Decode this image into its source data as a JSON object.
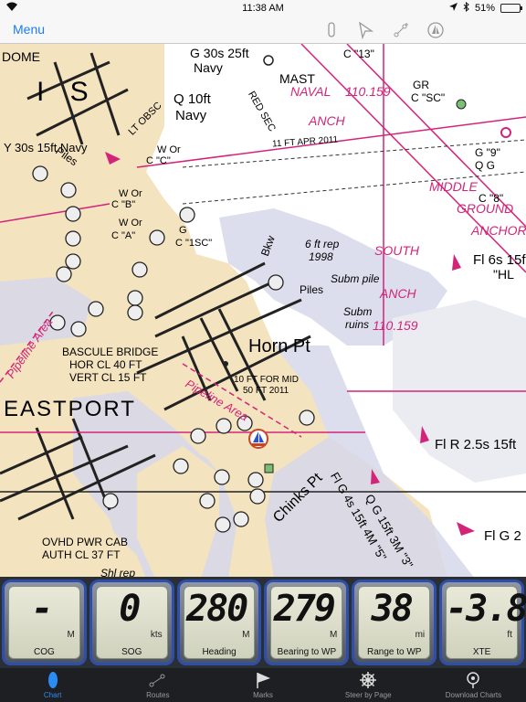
{
  "status_bar": {
    "time": "11:38 AM",
    "battery_percent": "51%",
    "battery_level": 0.51
  },
  "nav_bar": {
    "menu_label": "Menu"
  },
  "chart": {
    "place_labels": {
      "horn_pt": "Horn Pt",
      "eastport": "EASTPORT",
      "chinks_pt": "Chinks Pt",
      "dome": "DOME",
      "mast": "MAST",
      "is": "I S",
      "bkw": "Bkw",
      "piles1": "Piles",
      "piles2": "Piles",
      "middle": "MIDDLE",
      "ground": "GROUND",
      "anchor": "ANCHOR",
      "south": "SOUTH",
      "anch1": "ANCH",
      "anch2": "ANCH",
      "naval": "NAVAL",
      "naval_num": "110.159",
      "anch_num": "110.159"
    },
    "annotations": {
      "g30s": "G 30s 25ft",
      "navy1": "Navy",
      "q10ft": "Q 10ft",
      "navy2": "Navy",
      "lt_obsc": "LT OBSC",
      "y30s": "Y 30s 15ft Navy",
      "red_sec": "RED SEC",
      "wor1": "W Or",
      "c_c": "C \"C\"",
      "c13": "C \"13\"",
      "gr": "GR",
      "c_sc": "C \"SC\"",
      "g9": "G \"9\"",
      "qg1": "Q G",
      "c8": "C \"8\"",
      "fl6s": "Fl 6s 15f",
      "hl": "\"HL",
      "ft_rep": "6 ft rep",
      "year1998": "1998",
      "subm_pile": "Subm pile",
      "subm_ruins": "Subm",
      "ruins": "ruins",
      "bascule1": "BASCULE BRIDGE",
      "bascule2": "HOR CL 40 FT",
      "bascule3": "VERT CL 15 FT",
      "pipeline1": "Pipeline Area",
      "pipeline2": "Pipeline Area",
      "tenft1": "10 FT FOR MID",
      "tenft2": "50 FT 2011",
      "flr": "Fl R 2.5s 15ft",
      "qg15": "Q G 15ft 3M \"3\"",
      "flg4s": "Fl G 4s 15ft 4M \"5\"",
      "flg2": "Fl G 2",
      "ovhd1": "OVHD PWR CAB",
      "ovhd2": "AUTH CL 37 FT",
      "shl_rep": "Shl rep",
      "ft11": "11 FT APR 2011",
      "wor_c_b": "W Or",
      "c_b": "C \"B\"",
      "wor_c_a": "W Or",
      "c_a": "C \"A\"",
      "g_c_1sc": "G",
      "c_1sc": "C \"1SC\""
    }
  },
  "instruments": [
    {
      "value": "-",
      "unit": "M",
      "label": "COG"
    },
    {
      "value": "0",
      "unit": "kts",
      "label": "SOG"
    },
    {
      "value": "280",
      "unit": "M",
      "label": "Heading"
    },
    {
      "value": "279",
      "unit": "M",
      "label": "Bearing to WP"
    },
    {
      "value": "38",
      "unit": "mi",
      "label": "Range to WP"
    },
    {
      "value": "-3.8",
      "unit": "ft",
      "label": "XTE"
    }
  ],
  "tabs": [
    {
      "label": "Chart",
      "icon": "chart-tab-icon",
      "active": true
    },
    {
      "label": "Routes",
      "icon": "routes-tab-icon",
      "active": false
    },
    {
      "label": "Marks",
      "icon": "flag-icon",
      "active": false
    },
    {
      "label": "Steer by Page",
      "icon": "ship-wheel-icon",
      "active": false
    },
    {
      "label": "Download Charts",
      "icon": "download-icon",
      "active": false
    }
  ],
  "colors": {
    "accent": "#1b7cf5",
    "land": "#f4e3bf",
    "shoal": "#d6d8ea",
    "water": "#ffffff",
    "magenta": "#d4247a",
    "gauge_border": "#2f4ea8"
  }
}
